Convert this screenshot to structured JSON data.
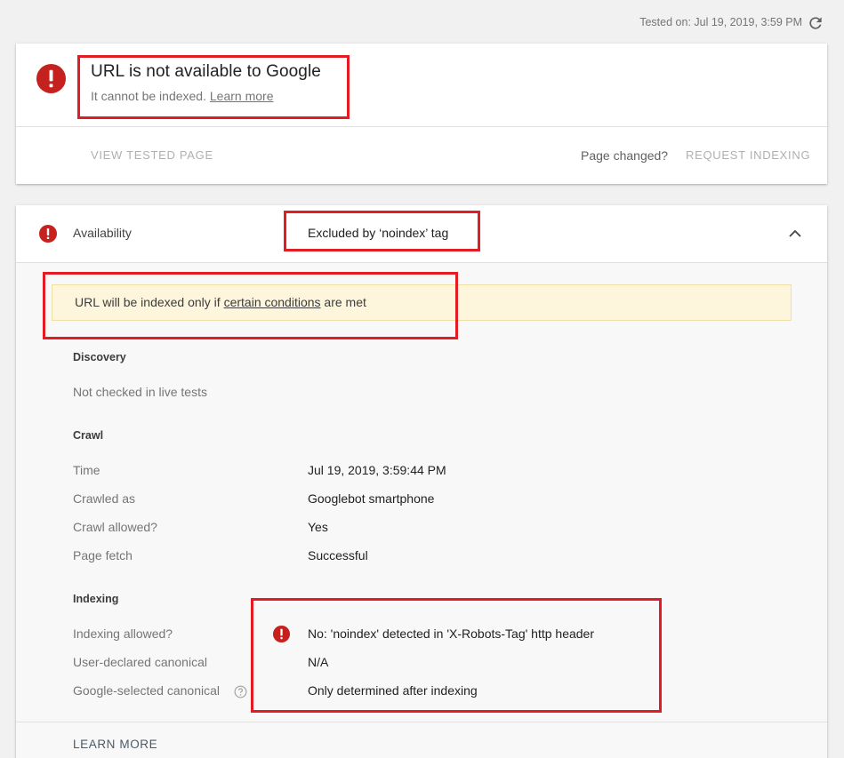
{
  "header": {
    "tested_on": "Tested on: Jul 19, 2019, 3:59 PM",
    "refresh_icon": "refresh-icon"
  },
  "status_card": {
    "title": "URL is not available to Google",
    "subtitle_prefix": "It cannot be indexed.",
    "learn_more_link": "Learn more",
    "view_tested_page": "VIEW TESTED PAGE",
    "page_changed": "Page changed?",
    "request_indexing": "REQUEST INDEXING",
    "error_icon": "error-icon"
  },
  "details_card": {
    "availability_label": "Availability",
    "availability_value": "Excluded by ‘noindex’ tag",
    "collapse_icon": "chevron-up-icon",
    "notice": {
      "prefix": "URL will be indexed only if",
      "link": "certain conditions",
      "suffix": "are met"
    },
    "discovery": {
      "heading": "Discovery",
      "text": "Not checked in live tests"
    },
    "crawl": {
      "heading": "Crawl",
      "rows": [
        {
          "label": "Time",
          "value": "Jul 19, 2019, 3:59:44 PM"
        },
        {
          "label": "Crawled as",
          "value": "Googlebot smartphone"
        },
        {
          "label": "Crawl allowed?",
          "value": "Yes"
        },
        {
          "label": "Page fetch",
          "value": "Successful"
        }
      ]
    },
    "indexing": {
      "heading": "Indexing",
      "rows": [
        {
          "label": "Indexing allowed?",
          "value": "No: 'noindex' detected in 'X-Robots-Tag' http header"
        },
        {
          "label": "User-declared canonical",
          "value": "N/A"
        },
        {
          "label": "Google-selected canonical",
          "value": "Only determined after indexing"
        }
      ]
    },
    "learn_more": "LEARN MORE"
  },
  "colors": {
    "error_red": "#c5221f",
    "annotation_red": "#e31b23",
    "notice_bg": "#fdf6dd"
  }
}
